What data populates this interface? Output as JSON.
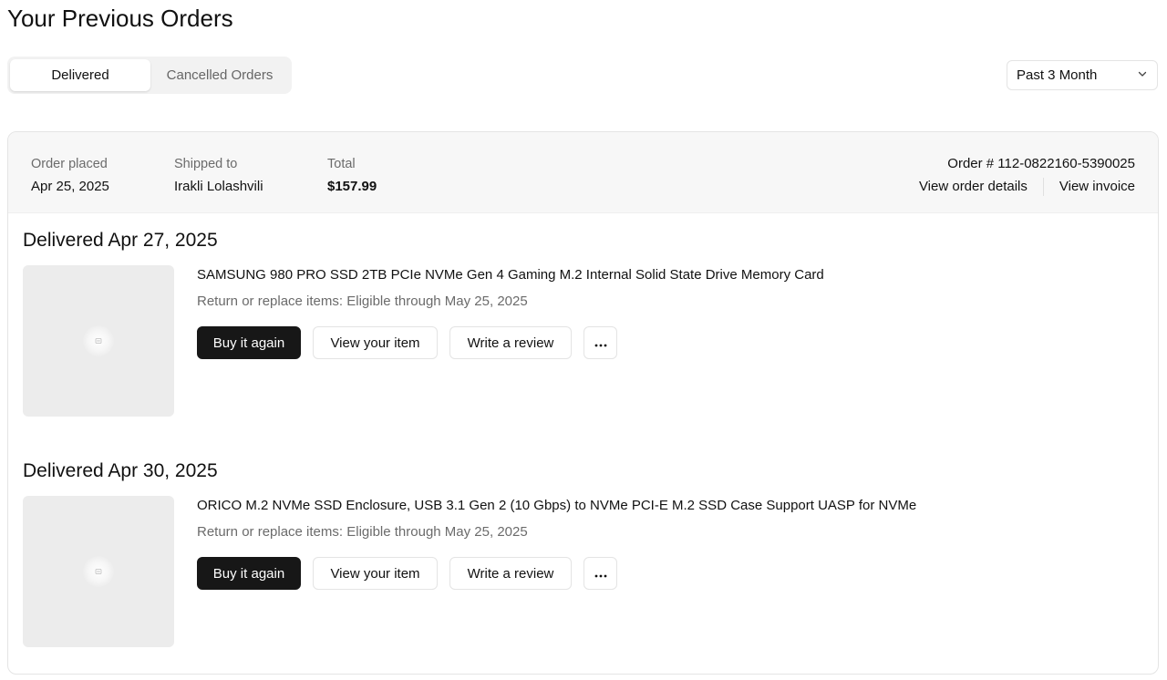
{
  "page": {
    "title": "Your Previous Orders"
  },
  "tabs": [
    {
      "label": "Delivered",
      "active": true
    },
    {
      "label": "Cancelled Orders",
      "active": false
    }
  ],
  "filter": {
    "selected": "Past 3 Month",
    "icon": "chevron-down-icon"
  },
  "order": {
    "placed_label": "Order placed",
    "placed_value": "Apr 25, 2025",
    "shipped_label": "Shipped to",
    "shipped_value": "Irakli Lolashvili",
    "total_label": "Total",
    "total_value": "$157.99",
    "order_number": "Order # 112-0822160-5390025",
    "view_details": "View order details",
    "view_invoice": "View invoice"
  },
  "shipments": [
    {
      "delivered": "Delivered Apr 27, 2025",
      "item_title": "SAMSUNG 980 PRO SSD 2TB PCIe NVMe Gen 4 Gaming M.2 Internal Solid State Drive Memory Card",
      "return_text": "Return or replace items: Eligible through May 25, 2025",
      "buy_again": "Buy it again",
      "view_item": "View your item",
      "write_review": "Write a review",
      "more": "more-icon"
    },
    {
      "delivered": "Delivered Apr 30, 2025",
      "item_title": "ORICO M.2 NVMe SSD Enclosure, USB 3.1 Gen 2 (10 Gbps) to NVMe PCI-E M.2 SSD Case Support UASP for NVMe",
      "return_text": "Return or replace items: Eligible through May 25, 2025",
      "buy_again": "Buy it again",
      "view_item": "View your item",
      "write_review": "Write a review",
      "more": "more-icon"
    }
  ],
  "colors": {
    "primary_button": "#171717",
    "header_bg": "#f7f7f7",
    "thumbnail_bg": "#ececec",
    "muted_text": "#6b6b6b",
    "border": "#e4e4e4"
  }
}
